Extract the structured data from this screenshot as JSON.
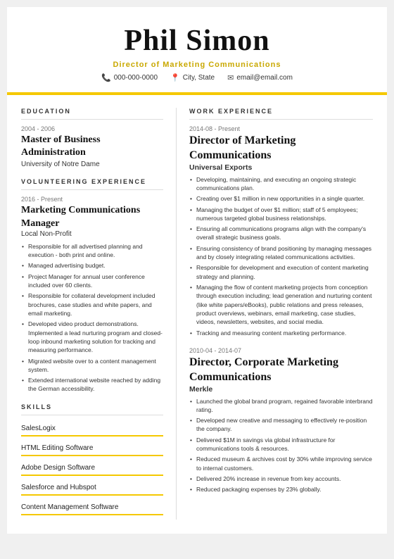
{
  "header": {
    "name": "Phil Simon",
    "title": "Director of Marketing Communications",
    "phone": "000-000-0000",
    "location": "City, State",
    "email": "email@email.com"
  },
  "education": {
    "section_title": "EDUCATION",
    "years": "2004 - 2006",
    "degree": "Master of Business Administration",
    "school": "University of Notre Dame"
  },
  "volunteering": {
    "section_title": "VOLUNTEERING EXPERIENCE",
    "years": "2016 - Present",
    "title_line1": "Marketing Communications",
    "title_line2": "Manager",
    "org": "Local Non-Profit",
    "bullets": [
      "Responsible for all advertised planning and execution - both print and online.",
      "Managed advertising budget.",
      "Project Manager for annual user conference included over 60 clients.",
      "Responsible for collateral development included brochures, case studies and white papers, and email marketing.",
      "Developed video product demonstrations. Implemented a lead nurturing program and closed-loop inbound marketing solution for tracking and measuring performance.",
      "Migrated website over to a content management system.",
      "Extended international website reached by adding the German accessibility."
    ]
  },
  "skills": {
    "section_title": "SKILLS",
    "items": [
      "SalesLogix",
      "HTML Editing Software",
      "Adobe Design Software",
      "Salesforce and Hubspot",
      "Content Management Software"
    ]
  },
  "work_experience": {
    "section_title": "WORK EXPERIENCE",
    "jobs": [
      {
        "years": "2014-08 - Present",
        "title": "Director of Marketing Communications",
        "company": "Universal Exports",
        "bullets": [
          "Developing, maintaining, and executing an ongoing strategic communications plan.",
          "Creating over $1 million in new opportunities in a single quarter.",
          "Managing the budget of over $1 million; staff of 5 employees; numerous targeted global business relationships.",
          "Ensuring all communications programs align with the company's overall strategic business goals.",
          "Ensuring consistency of brand positioning by managing messages and by closely integrating related communications activities.",
          "Responsible for development and execution of content marketing strategy and planning.",
          "Managing the flow of content marketing projects from conception through execution including; lead generation and nurturing content (like white papers/eBooks), public relations and press releases, product overviews, webinars, email marketing, case studies, videos, newsletters, websites, and social media.",
          "Tracking and measuring content marketing performance."
        ]
      },
      {
        "years": "2010-04 - 2014-07",
        "title_line1": "Director, Corporate Marketing",
        "title_line2": "Communications",
        "company": "Merkle",
        "bullets": [
          "Launched the global brand program, regained favorable interbrand rating.",
          "Developed new creative and messaging to effectively re-position the company.",
          "Delivered $1M in savings via global infrastructure for communications tools & resources.",
          "Reduced museum & archives cost by 30% while improving service to internal customers.",
          "Delivered 20% increase in revenue from key accounts.",
          "Reduced packaging expenses by 23% globally."
        ]
      }
    ]
  }
}
